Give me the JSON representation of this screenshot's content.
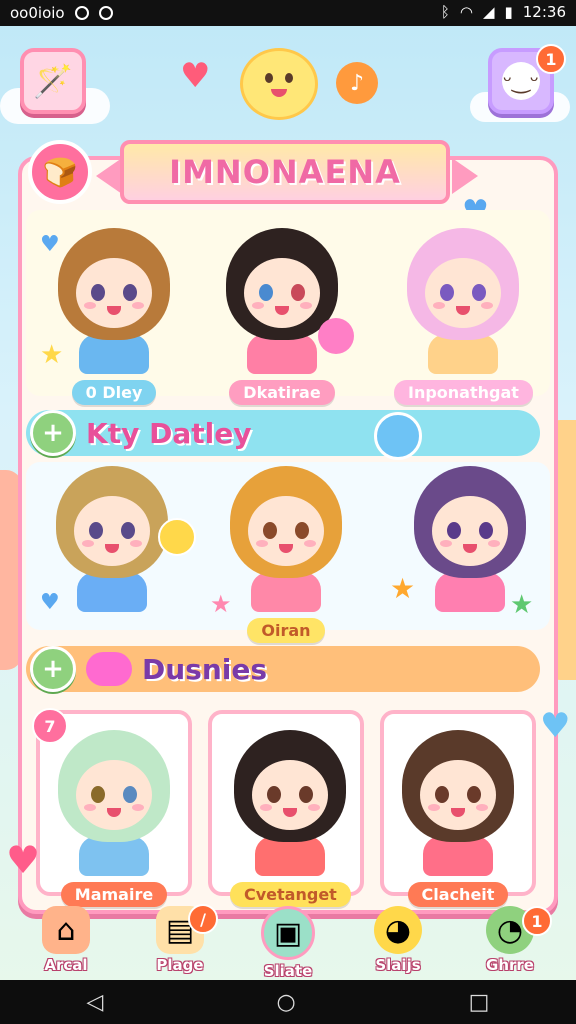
{
  "status_bar": {
    "left_text": "oo0ioio",
    "time": "12:36"
  },
  "top": {
    "left_button_icon": "magic-wand-icon",
    "right_button_icon": "smiley-icon",
    "right_badge": "1"
  },
  "banner": {
    "title": "IMNONAENA"
  },
  "section1": {
    "characters": [
      {
        "name": "0 Dley",
        "hair": "#b87a3a",
        "body": "#6ab7f0",
        "label_bg": "#7fd3f0",
        "label_color": "#ffffff"
      },
      {
        "name": "Dkatirae",
        "hair": "#2e2220",
        "body": "#ff7fa5",
        "label_bg": "#ff9dc0",
        "label_color": "#ffffff"
      },
      {
        "name": "Inponathgat",
        "hair": "#f5b8e6",
        "body": "#ffd28a",
        "label_bg": "#ffb5df",
        "label_color": "#ffffff"
      }
    ]
  },
  "section2": {
    "header_title": "Kty Datley",
    "characters": [
      {
        "name": "",
        "hair": "#c9a35a",
        "body": "#6aaef5"
      },
      {
        "name": "Oiran",
        "hair": "#e7a13a",
        "body": "#ff88a8",
        "label_bg": "#ffe466",
        "label_color": "#c15a2a"
      },
      {
        "name": "",
        "hair": "#6a4a8a",
        "body": "#ff7fb0"
      }
    ]
  },
  "section3": {
    "header_title": "Dusnies",
    "card_badge": "7",
    "characters": [
      {
        "name": "Mamaire",
        "hair": "#bfe8c8",
        "body": "#7ec2f0",
        "label_bg": "#ff7a55",
        "label_color": "#ffffff"
      },
      {
        "name": "Cvetanget",
        "hair": "#2e2220",
        "body": "#ff6f6f",
        "label_bg": "#ffe15a",
        "label_color": "#c15a2a"
      },
      {
        "name": "Clacheit",
        "hair": "#5a3a2a",
        "body": "#ff6f88",
        "label_bg": "#ff7a55",
        "label_color": "#ffffff"
      }
    ]
  },
  "dock": [
    {
      "label": "Arcal",
      "icon": "house-icon",
      "color": "#ffb38a"
    },
    {
      "label": "Plage",
      "icon": "book-icon",
      "color": "#ffe0a8",
      "badge": "/"
    },
    {
      "label": "Sliate",
      "icon": "box-icon",
      "color": "#9be0c8"
    },
    {
      "label": "Slaijs",
      "icon": "duck-icon",
      "color": "#ffd84a"
    },
    {
      "label": "Ghrre",
      "icon": "frog-icon",
      "color": "#8fd17e",
      "badge": "1"
    }
  ]
}
